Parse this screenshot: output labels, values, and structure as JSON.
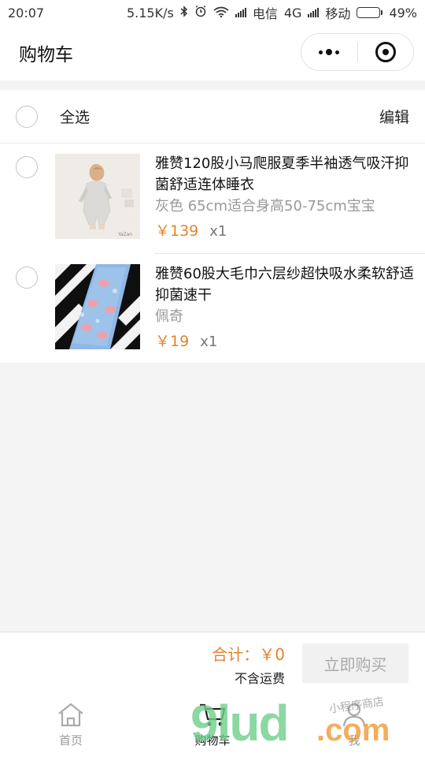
{
  "status_bar": {
    "time": "20:07",
    "speed": "5.15K/s",
    "carrier1": "电信",
    "network": "4G",
    "carrier2": "移动",
    "battery": "49%",
    "battery_level": 0.49
  },
  "navbar": {
    "title": "购物车"
  },
  "select_bar": {
    "select_all_label": "全选",
    "edit_label": "编辑"
  },
  "items": [
    {
      "name": "雅赞120股小马爬服夏季半袖透气吸汗抑菌舒适连体睡衣",
      "spec": "灰色 65cm适合身高50-75cm宝宝",
      "price": "￥139",
      "qty": "x1"
    },
    {
      "name": "雅赞60股大毛巾六层纱超快吸水柔软舒适抑菌速干",
      "spec": "佩奇",
      "price": "￥19",
      "qty": "x1"
    }
  ],
  "checkout": {
    "total_label": "合计：￥0",
    "shipping_note": "不含运费",
    "buy_label": "立即购买"
  },
  "tabbar": {
    "tabs": [
      {
        "label": "首页",
        "icon": "home-icon"
      },
      {
        "label": "购物车",
        "icon": "cart-icon"
      },
      {
        "label": "我",
        "icon": "user-icon"
      }
    ]
  },
  "watermark": {
    "main": "9lud",
    "suffix": ".com",
    "small": "小程序商店"
  },
  "colors": {
    "accent": "#e5832e",
    "muted": "#999999",
    "background": "#f4f4f4"
  }
}
